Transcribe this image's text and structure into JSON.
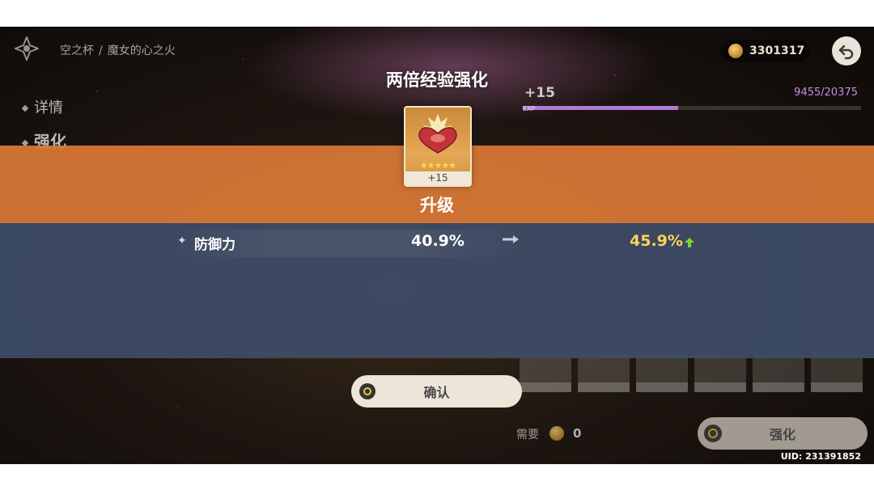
{
  "breadcrumb": {
    "part1": "空之杯",
    "separator": "/",
    "part2": "魔女的心之火"
  },
  "currency": {
    "mora_amount": "3301317",
    "icon": "mora-coin-icon"
  },
  "sidebar": {
    "details_label": "详情",
    "enhance_label": "强化"
  },
  "artifact_panel": {
    "level": "+15",
    "exp_text": "9455/20375",
    "exp_label": "EXP",
    "exp_progress": 0.46
  },
  "popup": {
    "title": "两倍经验强化",
    "item_level": "+15",
    "item_rarity_stars": "★★★★★",
    "upgrade_label": "升级",
    "stat": {
      "name": "防御力",
      "old_value": "40.9%",
      "new_value": "45.9%"
    },
    "confirm_label": "确认"
  },
  "footer": {
    "need_label": "需要",
    "need_value": "0",
    "enhance_button_label": "强化"
  },
  "uid": "UID: 231391852",
  "colors": {
    "orange_band": "#db7936",
    "blue_band": "#3e4c67",
    "highlight_value": "#ffd25a",
    "up_arrow": "#7bd630"
  }
}
